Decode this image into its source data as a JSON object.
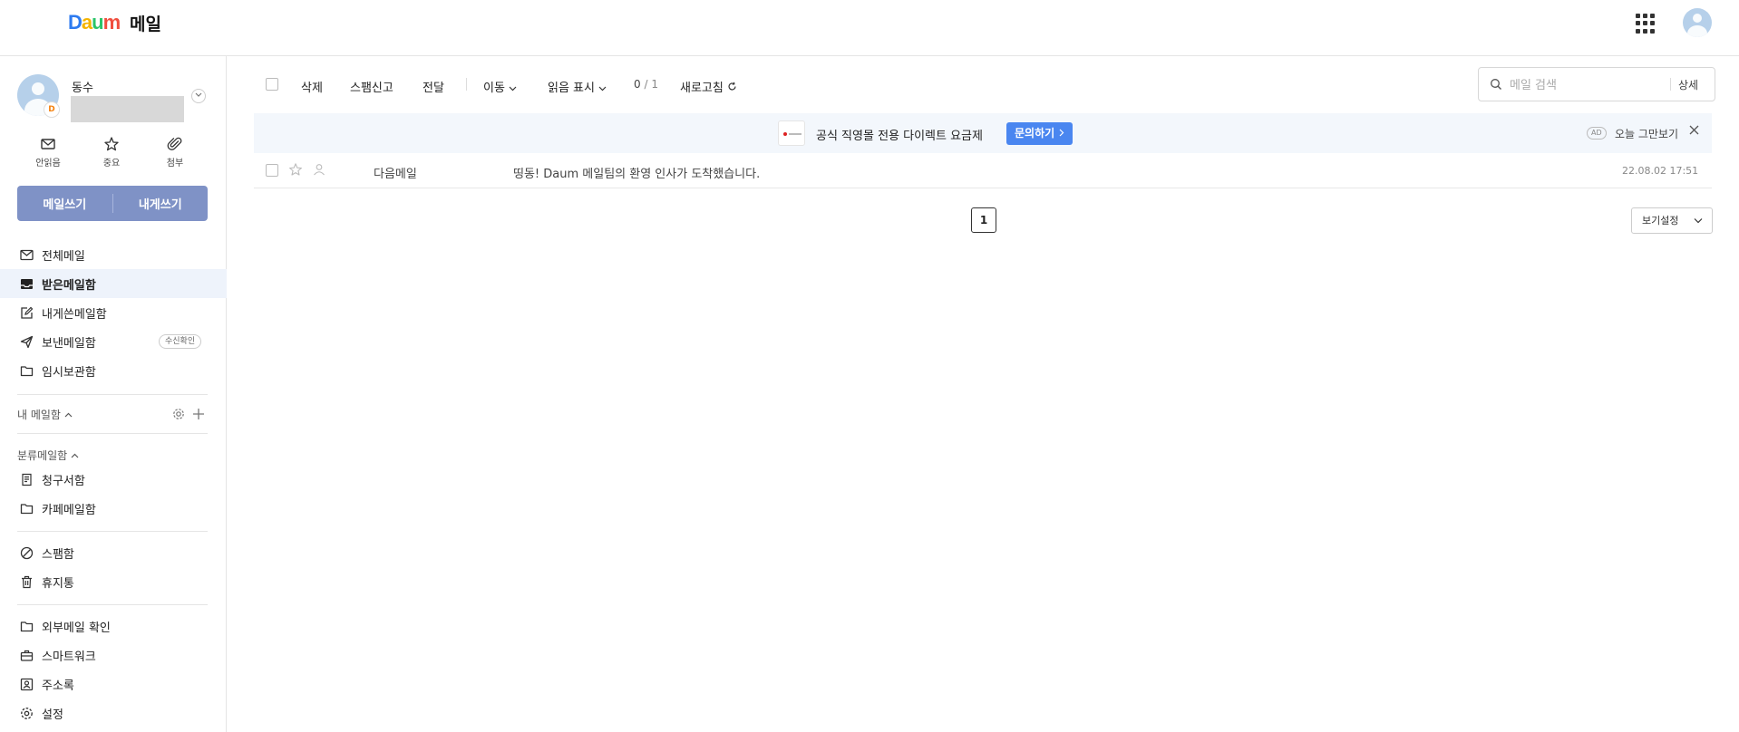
{
  "header": {
    "logo_letters": [
      "D",
      "a",
      "u",
      "m"
    ],
    "service_name": "메일"
  },
  "profile": {
    "name": "동수",
    "badge": "D"
  },
  "quick_actions": [
    {
      "label": "안읽음",
      "icon": "envelope-icon"
    },
    {
      "label": "중요",
      "icon": "star-icon"
    },
    {
      "label": "첨부",
      "icon": "paperclip-icon"
    }
  ],
  "write": {
    "write_label": "메일쓰기",
    "self_write_label": "내게쓰기"
  },
  "nav": {
    "all": "전체메일",
    "inbox": "받은메일함",
    "to_me": "내게쓴메일함",
    "sent": "보낸메일함",
    "sent_badge": "수신확인",
    "drafts": "임시보관함",
    "my_mailbox": "내 메일함",
    "classified": "분류메일함",
    "bills": "청구서함",
    "cafe": "카페메일함",
    "spam": "스팸함",
    "trash": "휴지통",
    "external": "외부메일 확인",
    "smartwork": "스마트워크",
    "contacts": "주소록",
    "settings": "설정"
  },
  "toolbar": {
    "delete": "삭제",
    "report_spam": "스팸신고",
    "forward": "전달",
    "move": "이동",
    "mark_read": "읽음 표시",
    "selected_count": "0",
    "total_count": "/ 1",
    "refresh": "새로고침"
  },
  "search": {
    "placeholder": "메일 검색",
    "detail": "상세"
  },
  "ad": {
    "text": "공식 직영몰 전용 다이렉트 요금제",
    "button": "문의하기",
    "mark": "AD",
    "hide_today": "오늘 그만보기"
  },
  "mails": [
    {
      "sender": "다음메일",
      "subject": "띵동! Daum 메일팀의 환영 인사가 도착했습니다.",
      "date": "22.08.02 17:51"
    }
  ],
  "pagination": {
    "current": "1"
  },
  "view_setting": "보기설정",
  "colors": {
    "write_button": "#7f92c6",
    "active_nav_bg": "#eef3fb",
    "ad_bg": "#f3f7fc",
    "ad_button": "#4a86f0"
  }
}
